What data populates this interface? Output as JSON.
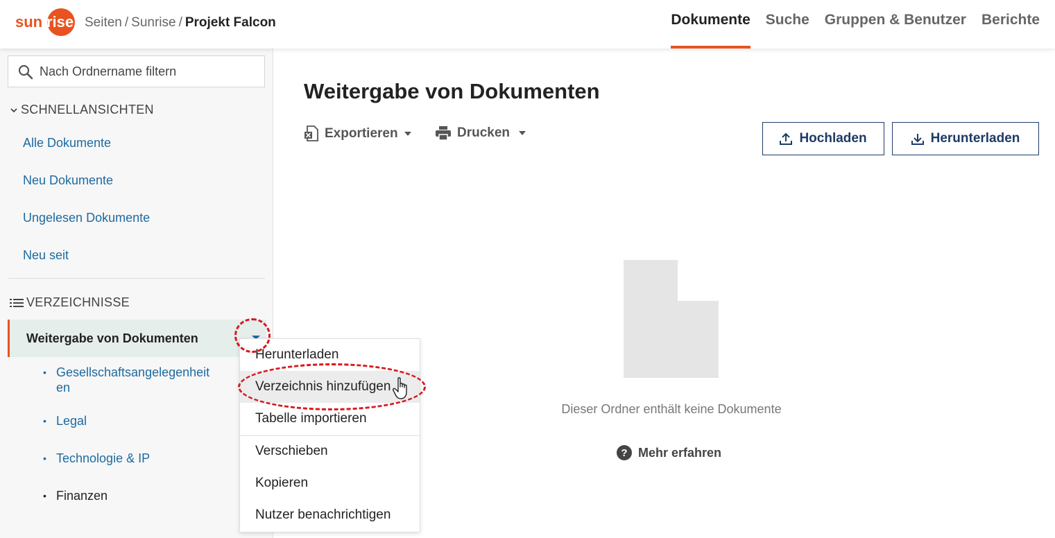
{
  "header": {
    "logo_text": {
      "sun": "sun",
      "rise": "rise"
    },
    "breadcrumb": {
      "item1": "Seiten",
      "item2": "Sunrise",
      "current": "Projekt Falcon",
      "separator": "/"
    },
    "nav": {
      "documents": "Dokumente",
      "search": "Suche",
      "groups": "Gruppen & Benutzer",
      "reports": "Berichte"
    }
  },
  "sidebar": {
    "filter_placeholder": "Nach Ordnername filtern",
    "quick_views": {
      "title": "SCHNELLANSICHTEN",
      "items": [
        "Alle Dokumente",
        "Neu Dokumente",
        "Ungelesen Dokumente",
        "Neu seit"
      ]
    },
    "directories": {
      "title": "VERZEICHNISSE",
      "active": "Weitergabe von Dokumenten",
      "children": [
        {
          "label": "Gesellschaftsangelegenheit",
          "label_cont": "en"
        },
        {
          "label": "Legal"
        },
        {
          "label": "Technologie & IP"
        },
        {
          "label": "Finanzen"
        }
      ]
    }
  },
  "main": {
    "title": "Weitergabe von Dokumenten",
    "toolbar": {
      "export": "Exportieren",
      "print": "Drucken"
    },
    "actions": {
      "upload": "Hochladen",
      "download": "Herunterladen"
    },
    "empty_message": "Dieser Ordner enthält keine Dokumente",
    "learn_more": "Mehr erfahren"
  },
  "context_menu": {
    "items": [
      "Herunterladen",
      "Verzeichnis hinzufügen",
      "Tabelle importieren",
      "Verschieben",
      "Kopieren",
      "Nutzer benachrichtigen"
    ],
    "hovered": "Verzeichnis hinzufügen"
  },
  "colors": {
    "accent": "#e8531f",
    "link": "#1d6aa1",
    "button_border": "#1e3a66",
    "highlight": "#d8181f"
  }
}
